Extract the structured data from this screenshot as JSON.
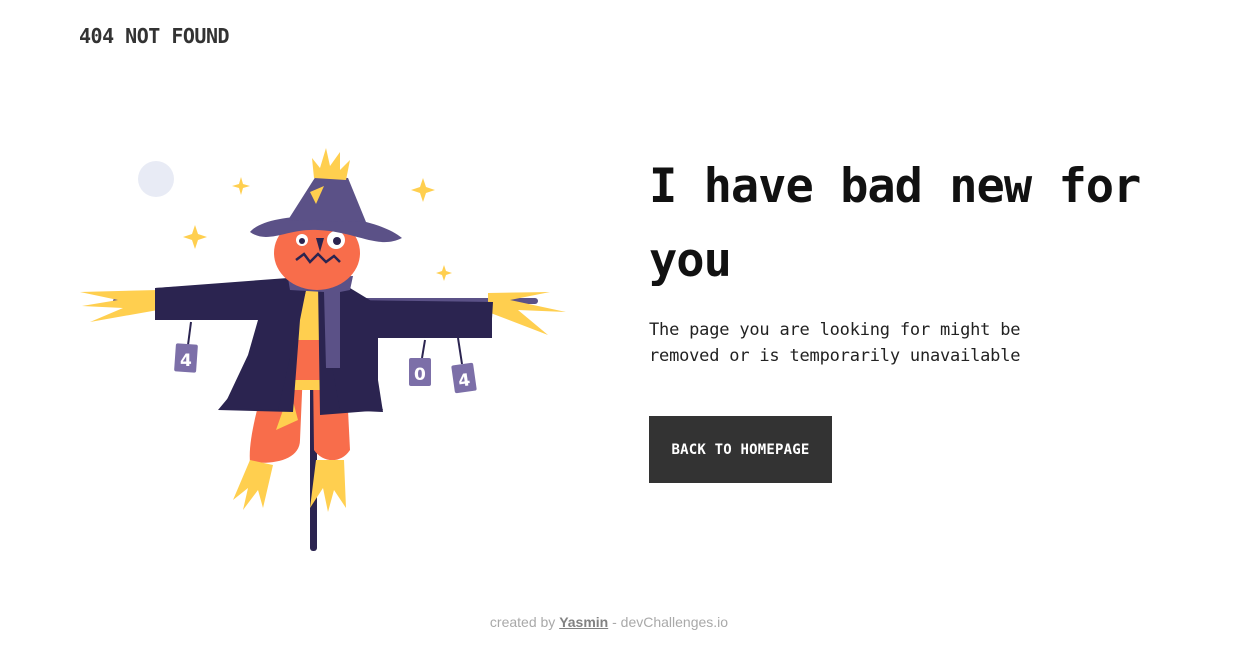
{
  "header": {
    "brand": "404 NOT FOUND"
  },
  "hero": {
    "headline": "I have bad new for you",
    "message": "The page you are looking for might be removed or is temporarily unavailable",
    "button_label": "BACK TO HOMEPAGE"
  },
  "illustration": {
    "name": "scarecrow-illustration",
    "can_digits": [
      "4",
      "0",
      "4"
    ]
  },
  "footer": {
    "prefix": "created by",
    "author": "Yasmin",
    "separator": " - ",
    "site": "devChallenges.io"
  },
  "colors": {
    "button_bg": "#333333",
    "hat": "#5b5187",
    "coat": "#2b2450",
    "face": "#f86d4b",
    "straw": "#ffcf4f",
    "moon": "#e8ebf5"
  }
}
